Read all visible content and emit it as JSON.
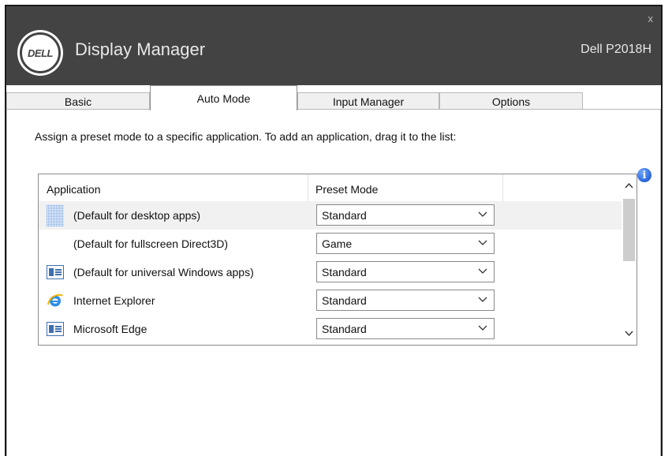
{
  "window": {
    "title": "Display Manager",
    "model": "Dell P2018H",
    "logo_text": "DELL",
    "close_label": "x",
    "info_label": "i"
  },
  "tabs": [
    {
      "label": "Basic",
      "active": false
    },
    {
      "label": "Auto Mode",
      "active": true
    },
    {
      "label": "Input Manager",
      "active": false
    },
    {
      "label": "Options",
      "active": false
    }
  ],
  "auto_mode": {
    "instruction": "Assign a preset mode to a specific application.  To add an application, drag it to the list:",
    "columns": {
      "application": "Application",
      "preset_mode": "Preset Mode"
    },
    "rows": [
      {
        "app": "(Default for desktop apps)",
        "mode": "Standard",
        "icon": "desktop-grid-icon",
        "selected": true
      },
      {
        "app": "(Default for fullscreen Direct3D)",
        "mode": "Game",
        "icon": "",
        "selected": false
      },
      {
        "app": "(Default for universal Windows apps)",
        "mode": "Standard",
        "icon": "window-app-icon",
        "selected": false
      },
      {
        "app": "Internet Explorer",
        "mode": "Standard",
        "icon": "internet-explorer-icon",
        "selected": false
      },
      {
        "app": "Microsoft Edge",
        "mode": "Standard",
        "icon": "window-app-icon",
        "selected": false
      }
    ]
  },
  "colors": {
    "titlebar": "#434343",
    "info": "#1f5fd8"
  }
}
